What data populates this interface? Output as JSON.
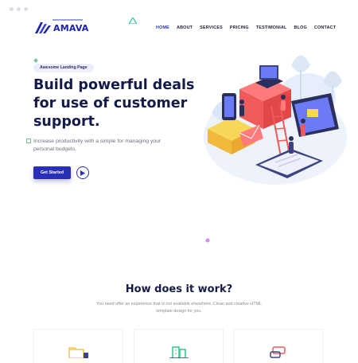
{
  "brand": {
    "name": "AMAVA"
  },
  "nav": {
    "items": [
      {
        "label": "HOME",
        "active": true
      },
      {
        "label": "ABOUT"
      },
      {
        "label": "SERVICES"
      },
      {
        "label": "PRICING"
      },
      {
        "label": "TESTIMONIAL"
      },
      {
        "label": "BLOG"
      },
      {
        "label": "CONTACT"
      }
    ]
  },
  "hero": {
    "badge": "Awesome Landing Page",
    "title": "Build powerful deals for use of customer support.",
    "description": "Increase productivity with a simple for managing your personal budgets.",
    "cta_label": "Get Started",
    "play_icon": "play-icon"
  },
  "how": {
    "title": "How does it work?",
    "description": "You need offer an experience that is not available elsewhere. Clean and creative HTML template design for you."
  },
  "features": [
    {
      "icon": "folder-icon",
      "color": "#f6c744"
    },
    {
      "icon": "building-icon",
      "color": "#34c68a"
    },
    {
      "icon": "chat-icon",
      "color": "#ee5a5a"
    }
  ],
  "colors": {
    "primary": "#2a2fb8",
    "heading": "#141a4a",
    "muted": "#6b6f80"
  }
}
